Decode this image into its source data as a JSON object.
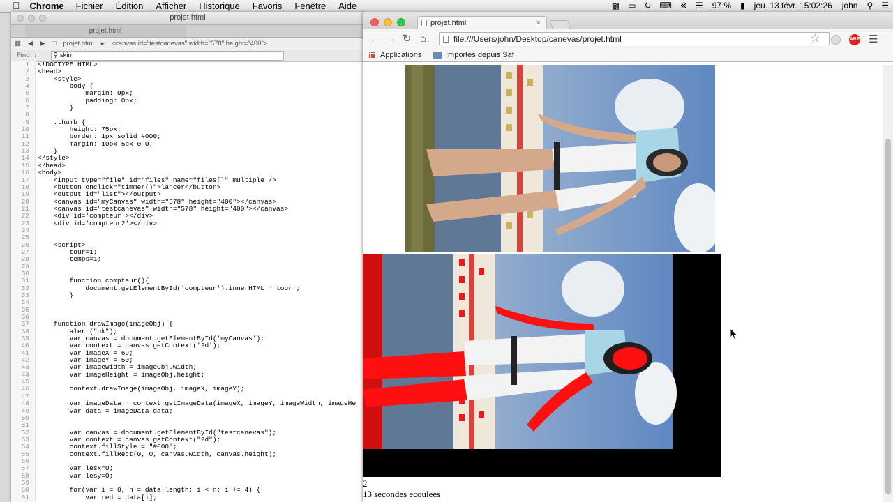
{
  "menubar": {
    "app": "Chrome",
    "items": [
      "Fichier",
      "Édition",
      "Afficher",
      "Historique",
      "Favoris",
      "Fenêtre",
      "Aide"
    ],
    "battery": "97 %",
    "datetime": "jeu. 13 févr.  15:02:26",
    "user": "john"
  },
  "editor": {
    "window_title": "projet.html",
    "tab_title": "projet.html",
    "path_file": "projet.html",
    "path_element": "<canvas id=\"testcanevas\" width=\"578\" height=\"400\">",
    "find_label": "Find",
    "find_value": "skin",
    "code_lines": [
      "<!DOCTYPE HTML>",
      "<head>",
      "    <style>",
      "        body {",
      "            margin: 0px;",
      "            padding: 0px;",
      "        }",
      "",
      "    .thumb {",
      "        height: 75px;",
      "        border: 1px solid #000;",
      "        margin: 10px 5px 0 0;",
      "    }",
      "</style>",
      "</head>",
      "<body>",
      "    <input type=\"file\" id=\"files\" name=\"files[]\" multiple />",
      "    <button onclick=\"timmer()\">lancer</button>",
      "    <output id=\"list\"></output>",
      "    <canvas id=\"myCanvas\" width=\"578\" height=\"400\"></canvas>",
      "    <canvas id=\"testcanevas\" width=\"578\" height=\"400\"></canvas>",
      "    <div id='compteur'></div>",
      "    <div id='compteur2'></div>",
      "",
      "",
      "    <script>",
      "        tour=1;",
      "        temps=1;",
      "",
      "",
      "        function compteur(){",
      "            document.getElementById('compteur').innerHTML = tour ;",
      "        }",
      "",
      "",
      "",
      "    function drawImage(imageObj) {",
      "        alert(\"ok\");",
      "        var canvas = document.getElementById('myCanvas');",
      "        var context = canvas.getContext('2d');",
      "        var imageX = 69;",
      "        var imageY = 50;",
      "        var imageWidth = imageObj.width;",
      "        var imageHeight = imageObj.height;",
      "",
      "        context.drawImage(imageObj, imageX, imageY);",
      "",
      "        var imageData = context.getImageData(imageX, imageY, imageWidth, imageHe",
      "        var data = imageData.data;",
      "",
      "",
      "        var canvas = document.getElementById(\"testcanevas\");",
      "        var context = canvas.getContext(\"2d\");",
      "        context.fillStyle = \"#000\";",
      "        context.fillRect(0, 0, canvas.width, canvas.height);",
      "",
      "        var lesx=0;",
      "        var lesy=0;",
      "",
      "        for(var i = 0, n = data.length; i < n; i += 4) {",
      "            var red = data[i];"
    ]
  },
  "browser": {
    "tab_title": "projet.html",
    "tab_close": "×",
    "url": "file:///Users/john/Desktop/canevas/projet.html",
    "bookmarks": {
      "apps": "Applications",
      "imported": "Importés depuis Saf"
    },
    "adblock_label": "ABP",
    "page": {
      "compteur": "2",
      "compteur2": "13 secondes ecoulees"
    }
  },
  "colors": {
    "skin_highlight": "#ff0000",
    "canvas_background": "#000000"
  }
}
